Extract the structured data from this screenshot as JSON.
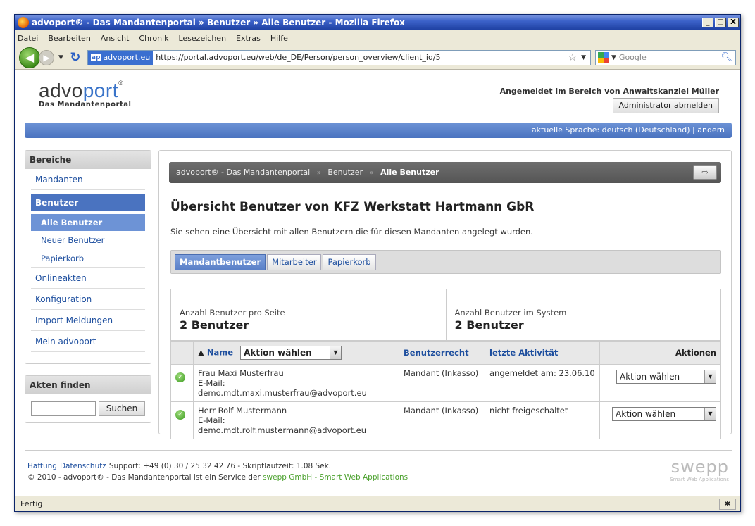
{
  "window": {
    "title": "advoport® - Das Mandantenportal » Benutzer » Alle Benutzer - Mozilla Firefox",
    "buttons": [
      "_",
      "□",
      "X"
    ]
  },
  "menu": [
    "Datei",
    "Bearbeiten",
    "Ansicht",
    "Chronik",
    "Lesezeichen",
    "Extras",
    "Hilfe"
  ],
  "nav": {
    "site_badge": "advoport.eu",
    "site_badge_short": "ap",
    "url": "https://portal.advoport.eu/web/de_DE/Person/person_overview/client_id/5",
    "search_placeholder": "Google"
  },
  "header": {
    "logo_main_1": "advo",
    "logo_main_2": "port",
    "logo_reg": "®",
    "logo_sub": "Das Mandantenportal",
    "login_info": "Angemeldet im Bereich von Anwaltskanzlei Müller",
    "logout_button": "Administrator abmelden",
    "language": "aktuelle Sprache: deutsch (Deutschland) | ändern"
  },
  "sidebar": {
    "title": "Bereiche",
    "items": {
      "mandanten": "Mandanten",
      "benutzer": "Benutzer",
      "alle_benutzer": "Alle Benutzer",
      "neuer_benutzer": "Neuer Benutzer",
      "papierkorb": "Papierkorb",
      "onlineakten": "Onlineakten",
      "konfiguration": "Konfiguration",
      "import": "Import Meldungen",
      "mein": "Mein advoport"
    },
    "find_title": "Akten finden",
    "find_button": "Suchen"
  },
  "breadcrumb": {
    "home": "advoport® - Das Mandantenportal",
    "sep": "»",
    "level1": "Benutzer",
    "current": "Alle Benutzer"
  },
  "main": {
    "title": "Übersicht Benutzer von KFZ Werkstatt Hartmann GbR",
    "description": "Sie sehen eine Übersicht mit allen Benutzern die für diesen Mandanten angelegt wurden.",
    "tabs": [
      "Mandantbenutzer",
      "Mitarbeiter",
      "Papierkorb"
    ],
    "stats": {
      "per_page_label": "Anzahl Benutzer pro Seite",
      "per_page_value": "2 Benutzer",
      "system_label": "Anzahl Benutzer im System",
      "system_value": "2 Benutzer"
    },
    "table": {
      "col_name": "Name",
      "col_name_sort": "▲",
      "bulk_action": "Aktion wählen",
      "col_right": "Benutzerrecht",
      "col_activity": "letzte Aktivität",
      "col_actions": "Aktionen",
      "rows": [
        {
          "name": "Frau Maxi Musterfrau",
          "email": "E-Mail: demo.mdt.maxi.musterfrau@advoport.eu",
          "right": "Mandant (Inkasso)",
          "activity": "angemeldet am: 23.06.10",
          "action": "Aktion wählen"
        },
        {
          "name": "Herr Rolf Mustermann",
          "email": "E-Mail: demo.mdt.rolf.mustermann@advoport.eu",
          "right": "Mandant (Inkasso)",
          "activity": "nicht freigeschaltet",
          "action": "Aktion wählen"
        }
      ]
    }
  },
  "footer": {
    "haftung": "Haftung",
    "datenschutz": "Datenschutz",
    "support": "Support: +49 (0) 30 / 25 32 42 76 - Skriptlaufzeit: 1.08 Sek.",
    "copyright": "© 2010 - advoport® - Das Mandantenportal ist ein Service der",
    "swepp_link": "swepp GmbH - Smart Web Applications",
    "swepp_logo": "swepp",
    "swepp_tagline": "Smart Web Applications"
  },
  "status": "Fertig",
  "colors": {
    "accent": "#4a73c0",
    "link": "#1d4e9e",
    "success": "#3a9a1e"
  }
}
